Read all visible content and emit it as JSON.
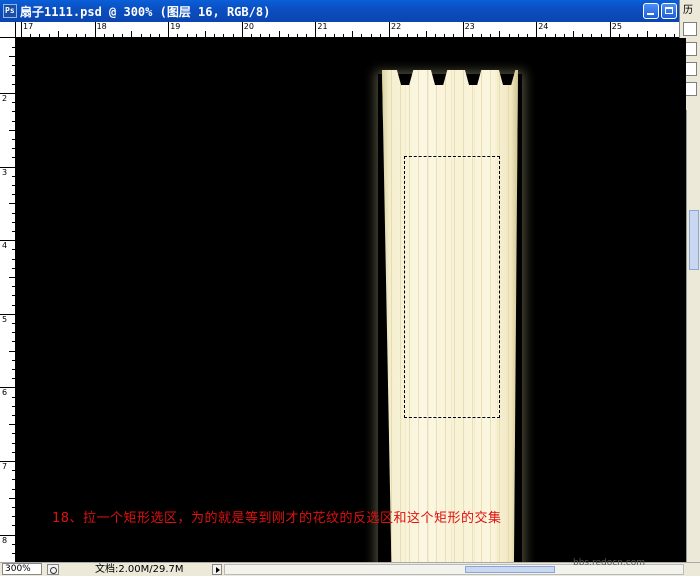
{
  "window": {
    "title": "扇子1111.psd @ 300% (图层 16, RGB/8)",
    "app_icon": "photoshop-icon"
  },
  "side_panel": {
    "label": "历"
  },
  "ruler_top": {
    "labels": [
      "17",
      "18",
      "19",
      "20",
      "21",
      "22",
      "23",
      "24",
      "25"
    ]
  },
  "ruler_left": {
    "labels": [
      "2",
      "3",
      "4",
      "5",
      "6",
      "7",
      "8"
    ]
  },
  "caption": "18、拉一个矩形选区，为的就是等到刚才的花纹的反选区和这个矩形的交集",
  "watermark": {
    "url": "bbs.redocn.com"
  },
  "status_bar": {
    "zoom": "300%",
    "doc_info": "文档:2.00M/29.7M"
  }
}
